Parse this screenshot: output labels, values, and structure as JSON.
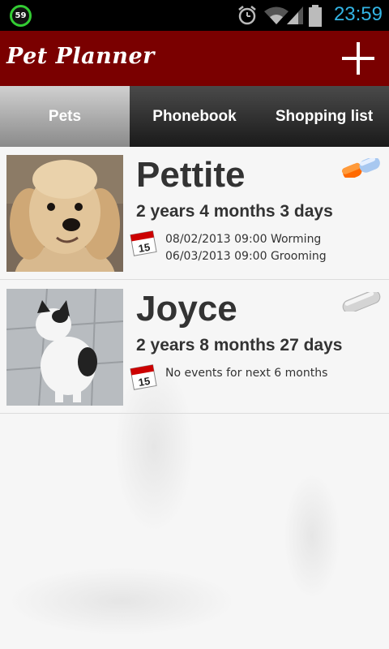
{
  "status_bar": {
    "notification_badge": "59",
    "time": "23:59"
  },
  "app_bar": {
    "title": "Pet Planner",
    "add_icon": "plus-icon"
  },
  "tabs": [
    {
      "label": "Pets",
      "active": true
    },
    {
      "label": "Phonebook",
      "active": false
    },
    {
      "label": "Shopping list",
      "active": false
    }
  ],
  "pets": [
    {
      "name": "Pettite",
      "age": "2 years 4 months 3 days",
      "events": [
        "08/02/2013 09:00 Worming",
        "06/03/2013 09:00 Grooming"
      ],
      "medication_icon": "pill-colored-icon"
    },
    {
      "name": "Joyce",
      "age": "2 years 8 months 27 days",
      "events": [
        "No events for next 6 months"
      ],
      "medication_icon": "pill-gray-icon"
    }
  ],
  "calendar_icon_day": "15",
  "colors": {
    "app_bar": "#7a0000",
    "status_time": "#33b5e5",
    "tab_active_top": "#d0d0d0",
    "tab_inactive": "#2a2a2a",
    "pill_orange": "#ff6a00",
    "pill_blue": "#a8c8f0"
  }
}
